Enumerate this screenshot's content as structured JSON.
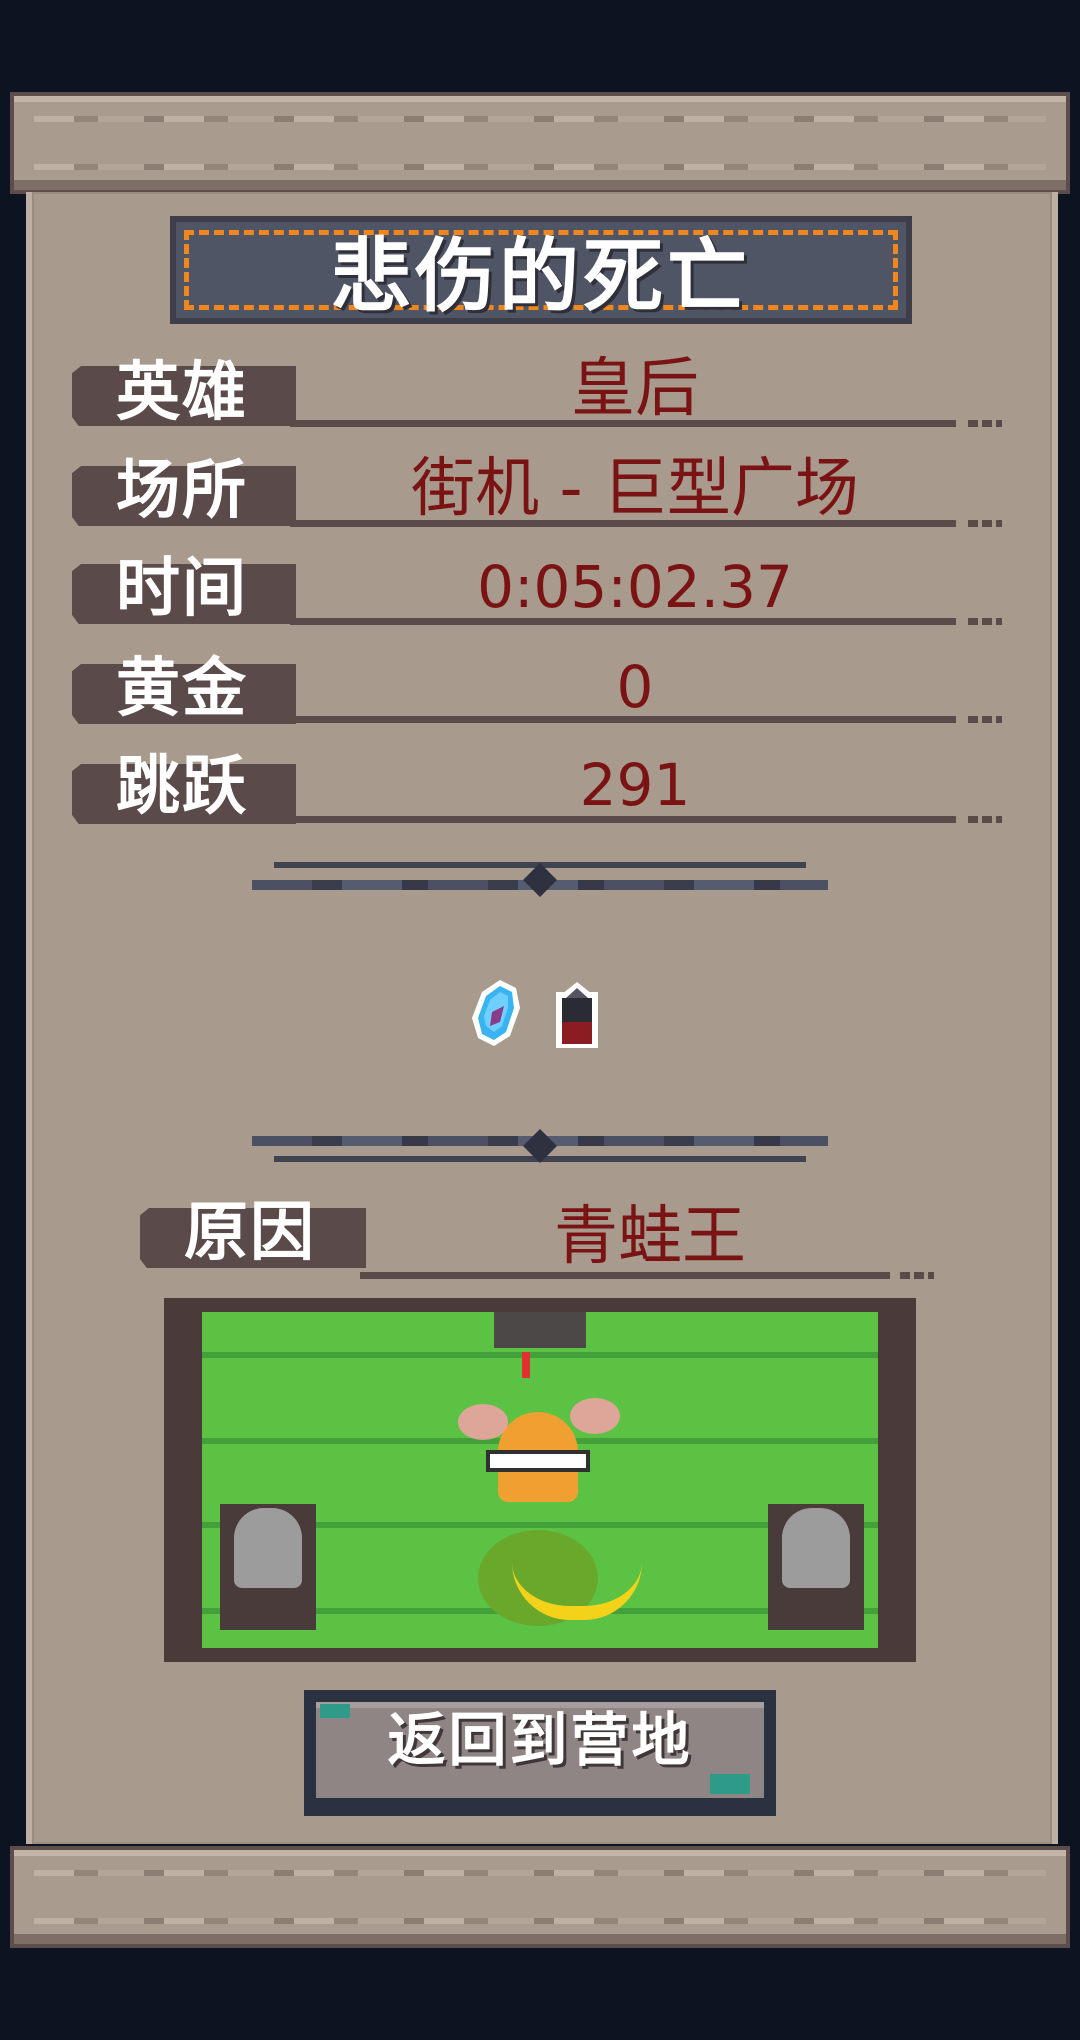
{
  "title": "悲伤的死亡",
  "stats": [
    {
      "label": "英雄",
      "value": "皇后"
    },
    {
      "label": "场所",
      "value": "街机 - 巨型广场"
    },
    {
      "label": "时间",
      "value": "0:05:02.37"
    },
    {
      "label": "黄金",
      "value": "0"
    },
    {
      "label": "跳跃",
      "value": "291"
    }
  ],
  "items": [
    {
      "icon": "blue-crystal-icon"
    },
    {
      "icon": "bullet-icon"
    }
  ],
  "cause": {
    "label": "原因",
    "value": "青蛙王"
  },
  "button": {
    "label": "返回到营地"
  },
  "colors": {
    "background": "#0c1421",
    "parchment": "#a89a8c",
    "value_text": "#7a1414",
    "title_border": "#f0871e",
    "grass": "#5cc244"
  }
}
